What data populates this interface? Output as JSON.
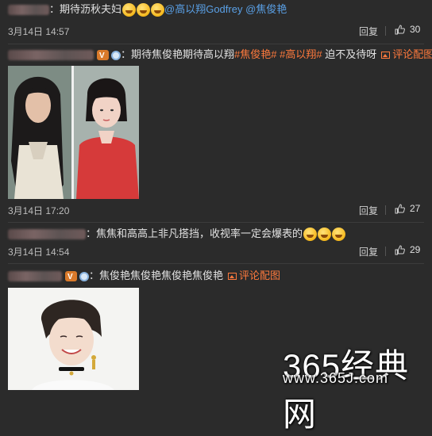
{
  "comments": [
    {
      "text": "：期待沥秋夫妇",
      "mentions": [
        "@高以翔Godfrey",
        "@焦俊艳"
      ],
      "time": "3月14日 14:57",
      "reply_label": "回复",
      "likes": "30"
    },
    {
      "text_prefix": "：期待焦俊艳期待高以翔",
      "tags": [
        "#焦俊艳#",
        "#高以翔#"
      ],
      "text_suffix": "迫不及待呀",
      "config_label": "评论配图",
      "time": "3月14日 17:20",
      "reply_label": "回复",
      "likes": "27"
    },
    {
      "text": "：焦焦和高高上非凡搭挡，收视率一定会爆表的",
      "time": "3月14日 14:54",
      "reply_label": "回复",
      "likes": "29"
    },
    {
      "text": "：焦俊艳焦俊艳焦俊艳焦俊艳",
      "config_label": "评论配图"
    }
  ],
  "watermark": {
    "title": "365经典网",
    "url": "www.365J.com"
  },
  "icons": {
    "emoji": "laughing-emoji-icon",
    "like": "thumbs-up-icon",
    "vip": "vip-badge-icon",
    "medal": "medal-icon",
    "image": "image-icon"
  }
}
